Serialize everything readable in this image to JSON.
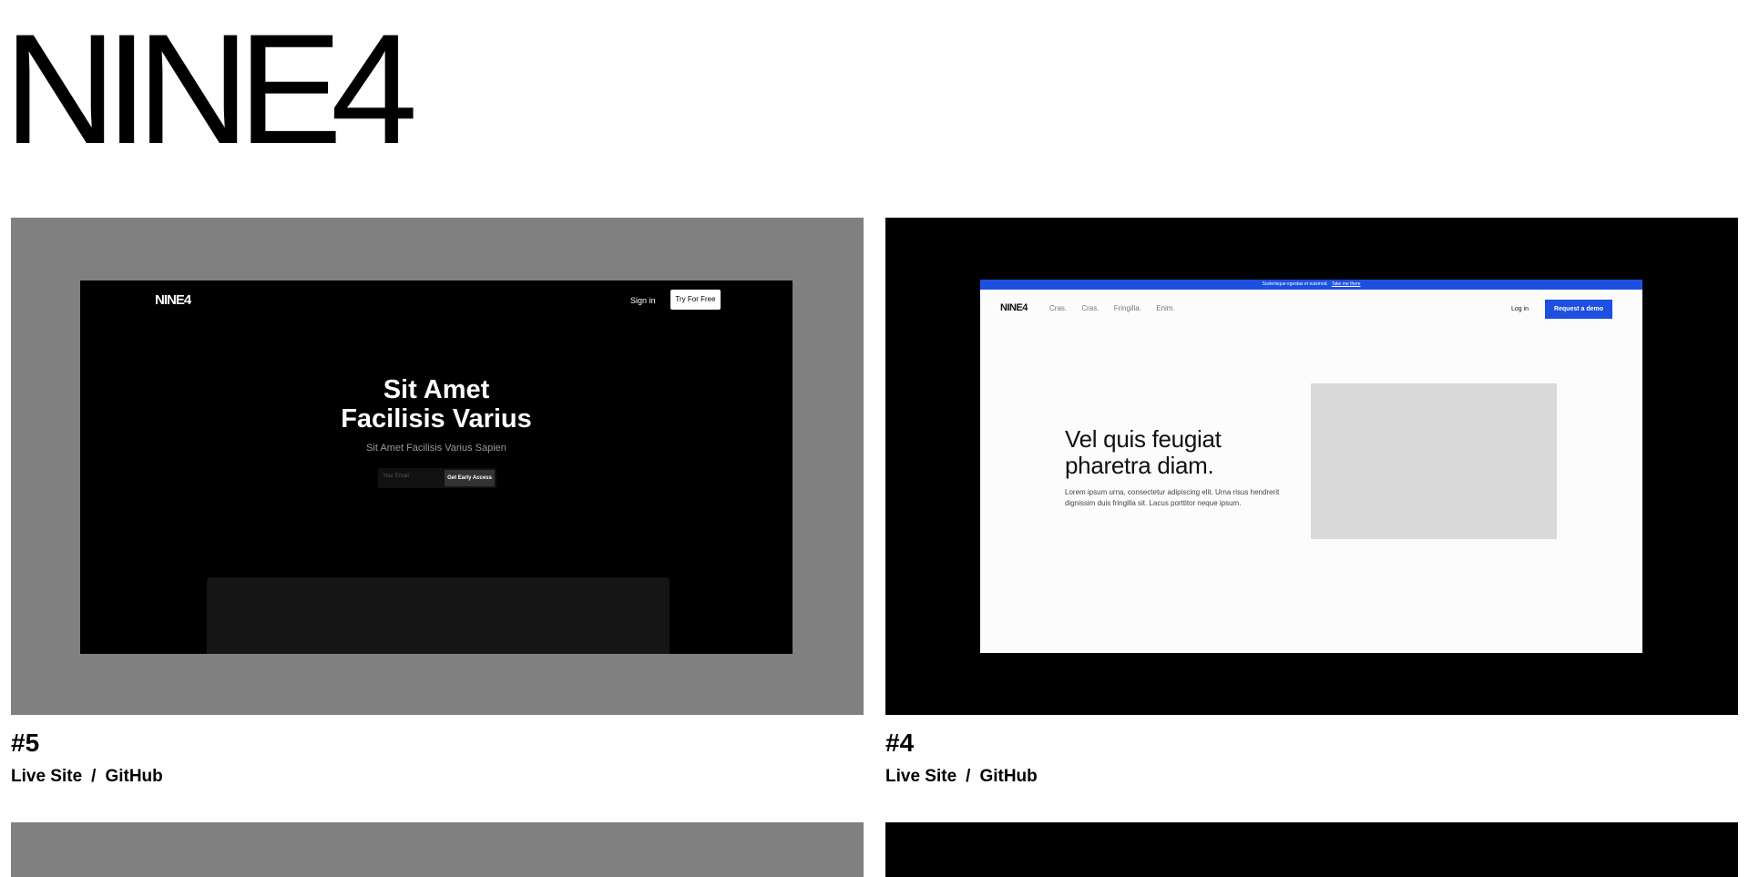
{
  "brand": "NINE4",
  "projects": [
    {
      "title": "#5",
      "live_label": "Live Site",
      "separator": "/",
      "github_label": "GitHub",
      "preview": {
        "logo": "NINE4",
        "signin": "Sign in",
        "try_button": "Try For Free",
        "hero_line1": "Sit Amet",
        "hero_line2": "Facilisis Varius",
        "subtitle": "Sit Amet Facilisis Varius Sapien",
        "email_placeholder": "Your Email",
        "cta": "Get Early Access"
      }
    },
    {
      "title": "#4",
      "live_label": "Live Site",
      "separator": "/",
      "github_label": "GitHub",
      "preview": {
        "banner_text": "Scelerisque egestas et euismod.",
        "banner_link": "Take me there",
        "logo": "NINE4",
        "nav": [
          "Cras.",
          "Cras.",
          "Fringilla.",
          "Enim."
        ],
        "login": "Log in",
        "demo_button": "Request a demo",
        "hero_line1": "Vel quis feugiat",
        "hero_line2": "pharetra diam.",
        "description": "Lorem ipsum urna, consectetur adipiscing elit. Urna risus hendrerit dignissim duis fringilla sit. Lacus porttitor neque ipsum."
      }
    }
  ],
  "colors": {
    "accent_blue": "#1d4fe0",
    "thumb_gray": "#808080",
    "thumb_black": "#000000"
  }
}
